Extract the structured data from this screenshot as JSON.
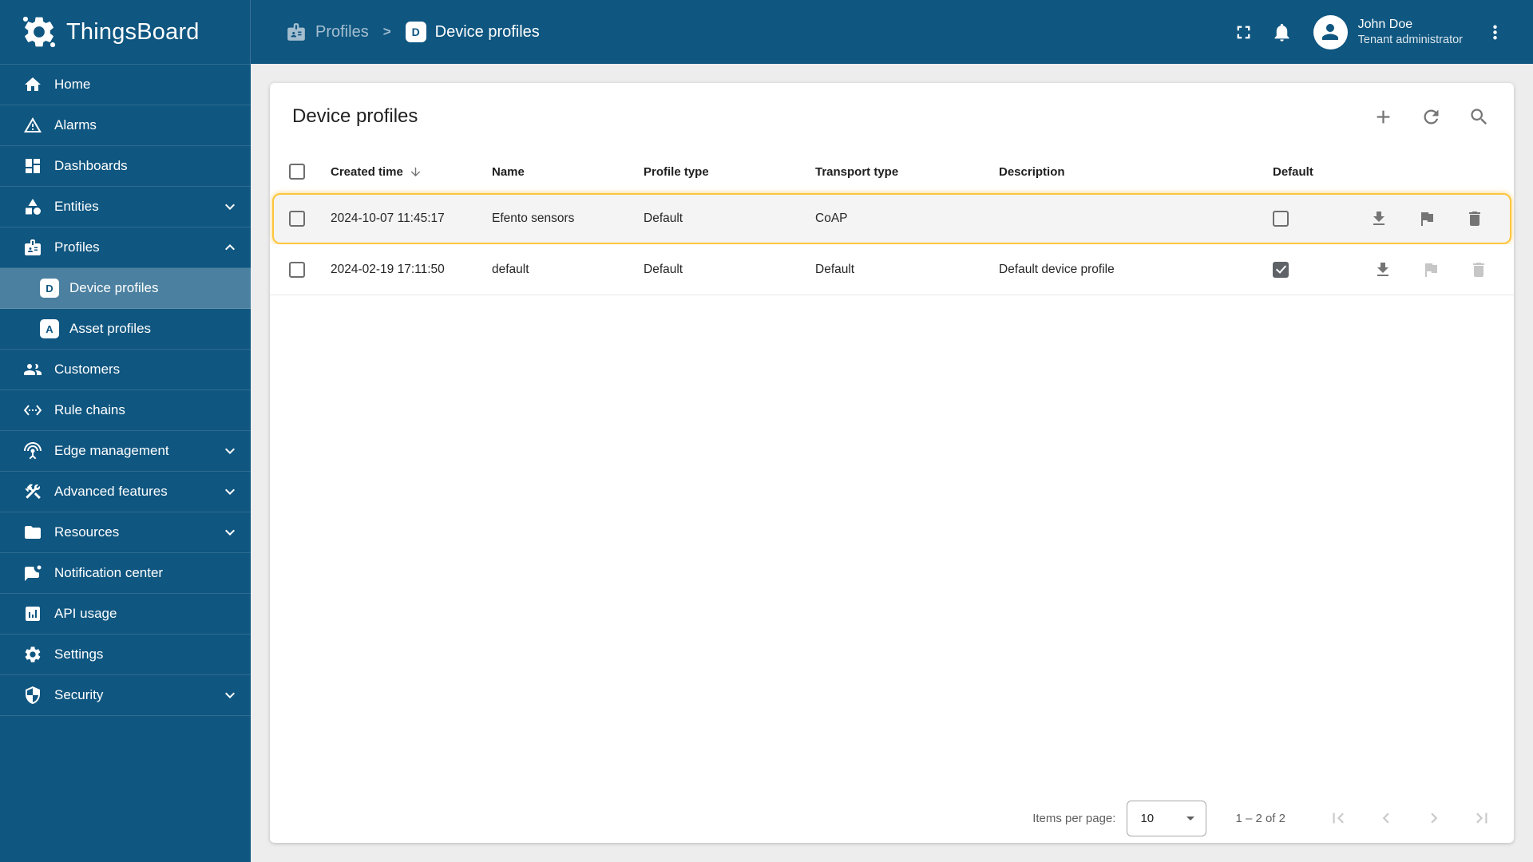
{
  "app": {
    "name": "ThingsBoard"
  },
  "breadcrumb": {
    "parent": "Profiles",
    "separator": ">",
    "current": "Device profiles",
    "current_badge_letter": "D"
  },
  "user": {
    "name": "John Doe",
    "role": "Tenant administrator"
  },
  "sidebar": {
    "items": [
      {
        "label": "Home",
        "icon": "home-icon"
      },
      {
        "label": "Alarms",
        "icon": "alarm-warning-icon"
      },
      {
        "label": "Dashboards",
        "icon": "dashboards-icon"
      },
      {
        "label": "Entities",
        "icon": "entities-icon",
        "chevron": "down"
      },
      {
        "label": "Profiles",
        "icon": "badge-icon",
        "chevron": "up"
      },
      {
        "label": "Device profiles",
        "badge": "D",
        "selected": true
      },
      {
        "label": "Asset profiles",
        "badge": "A"
      },
      {
        "label": "Customers",
        "icon": "customers-icon"
      },
      {
        "label": "Rule chains",
        "icon": "rule-chains-icon"
      },
      {
        "label": "Edge management",
        "icon": "antenna-icon",
        "chevron": "down"
      },
      {
        "label": "Advanced features",
        "icon": "construction-icon",
        "chevron": "down"
      },
      {
        "label": "Resources",
        "icon": "folder-icon",
        "chevron": "down"
      },
      {
        "label": "Notification center",
        "icon": "notification-icon"
      },
      {
        "label": "API usage",
        "icon": "api-usage-icon"
      },
      {
        "label": "Settings",
        "icon": "gear-icon"
      },
      {
        "label": "Security",
        "icon": "shield-icon",
        "chevron": "down"
      }
    ]
  },
  "page": {
    "title": "Device profiles"
  },
  "table": {
    "columns": {
      "created": "Created time",
      "name": "Name",
      "profile_type": "Profile type",
      "transport_type": "Transport type",
      "description": "Description",
      "default": "Default"
    },
    "sort": {
      "column": "Created time",
      "direction": "desc"
    },
    "rows": [
      {
        "created": "2024-10-07 11:45:17",
        "name": "Efento sensors",
        "profile_type": "Default",
        "transport_type": "CoAP",
        "description": "",
        "default_checked": false,
        "highlighted": true
      },
      {
        "created": "2024-02-19 17:11:50",
        "name": "default",
        "profile_type": "Default",
        "transport_type": "Default",
        "description": "Default device profile",
        "default_checked": true,
        "highlighted": false
      }
    ]
  },
  "pagination": {
    "items_per_page_label": "Items per page:",
    "page_size": "10",
    "range_label": "1 – 2 of 2"
  },
  "colors": {
    "primary": "#0f5680",
    "row_highlight_border": "#fcc53d",
    "row_highlight_bg": "#f4f4f4",
    "icon_enabled": "#757575",
    "icon_disabled": "#c6c6c6"
  }
}
